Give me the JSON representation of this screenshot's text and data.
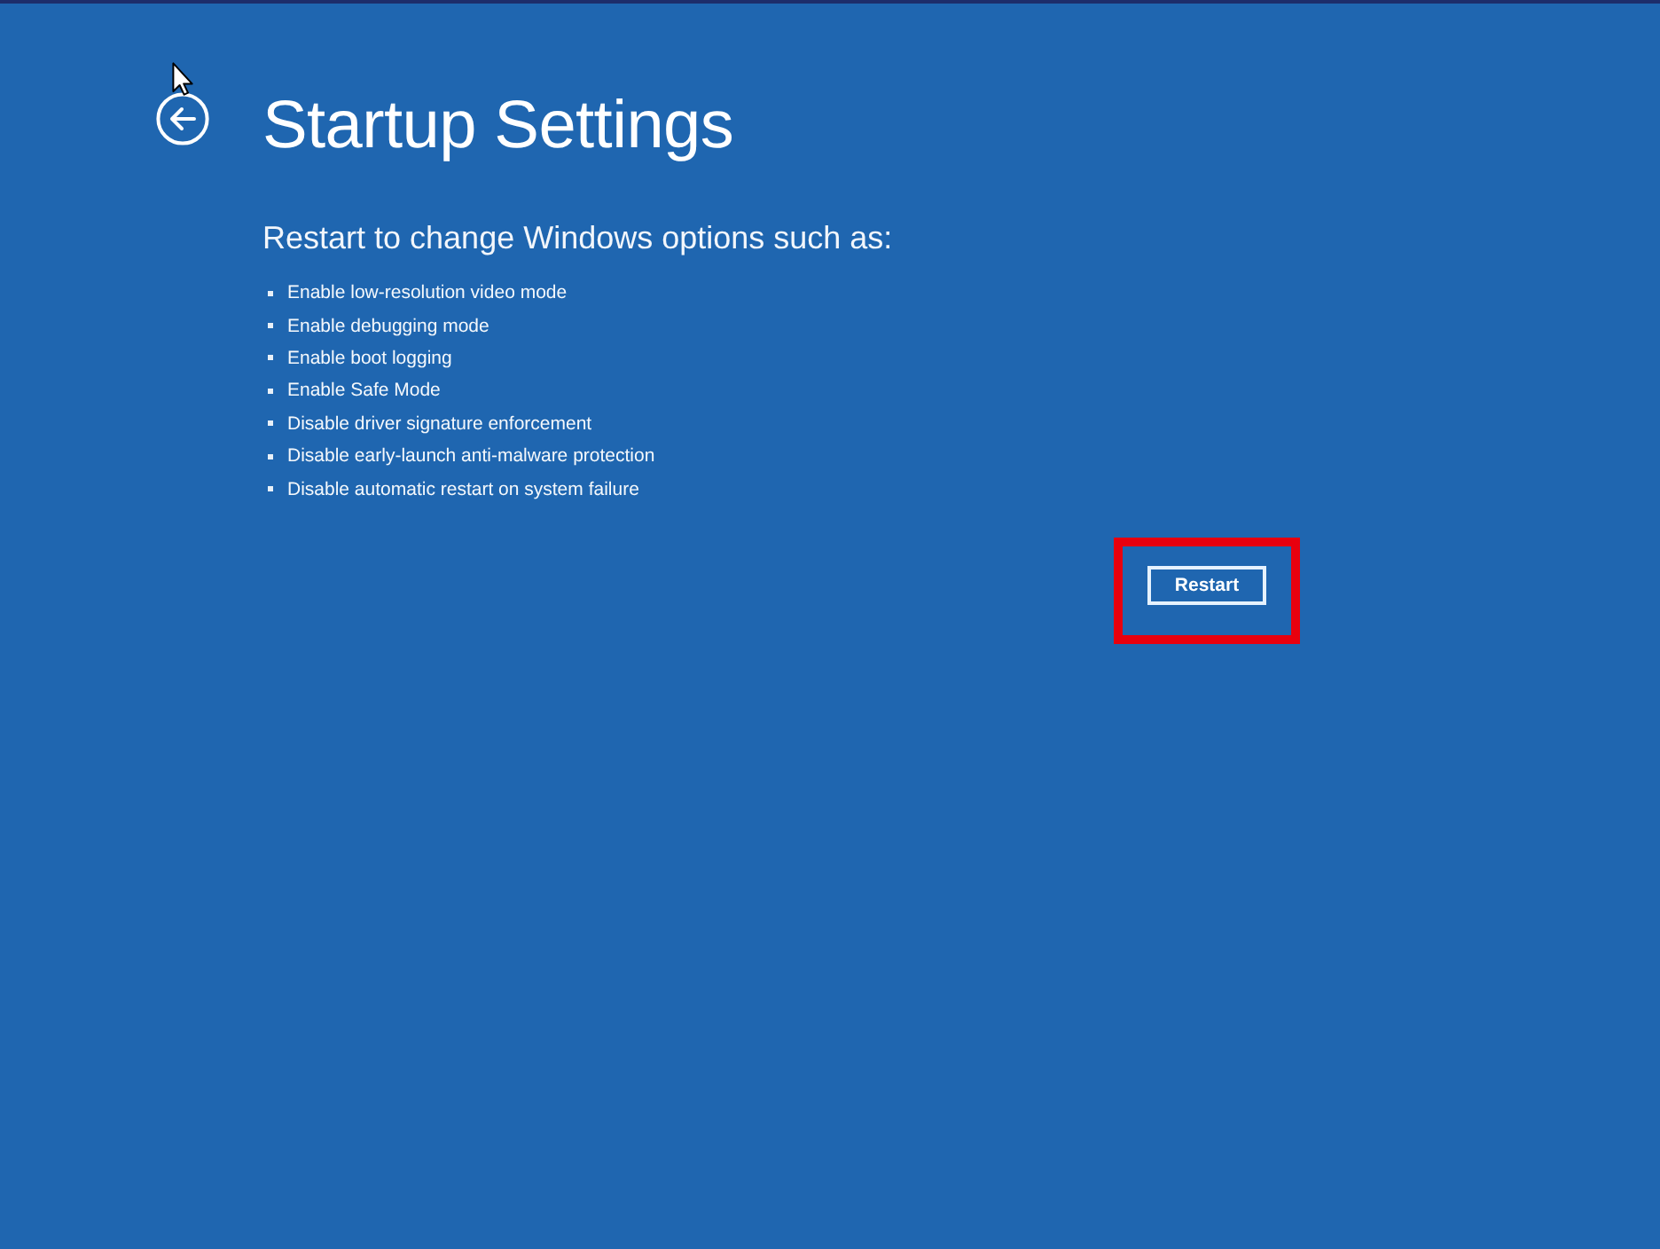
{
  "title": "Startup Settings",
  "subtitle": "Restart to change Windows options such as:",
  "options": [
    "Enable low-resolution video mode",
    "Enable debugging mode",
    "Enable boot logging",
    "Enable Safe Mode",
    "Disable driver signature enforcement",
    "Disable early-launch anti-malware protection",
    "Disable automatic restart on system failure"
  ],
  "restart_button": {
    "label": "Restart",
    "highlighted": true
  }
}
